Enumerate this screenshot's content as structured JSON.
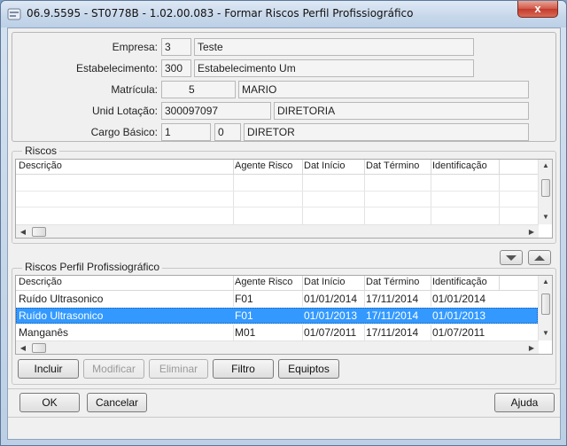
{
  "window": {
    "title": "06.9.5595 - ST0778B - 1.02.00.083 - Formar Riscos Perfil Profissiográfico",
    "close_label": "x"
  },
  "header": {
    "empresa_label": "Empresa:",
    "empresa_code": "3",
    "empresa_name": "Teste",
    "estabelecimento_label": "Estabelecimento:",
    "estabelecimento_code": "300",
    "estabelecimento_name": "Estabelecimento Um",
    "matricula_label": "Matrícula:",
    "matricula_code": "5",
    "matricula_name": "MARIO",
    "unid_lotacao_label": "Unid Lotação:",
    "unid_lotacao_code": "300097097",
    "unid_lotacao_name": "DIRETORIA",
    "cargo_label": "Cargo Básico:",
    "cargo_code": "1",
    "cargo_level": "0",
    "cargo_name": "DIRETOR"
  },
  "riscos": {
    "title": "Riscos",
    "columns": [
      "Descrição",
      "Agente Risco",
      "Dat Início",
      "Dat Término",
      "Identificação"
    ]
  },
  "perfil": {
    "title": "Riscos Perfil Profissiográfico",
    "columns": [
      "Descrição",
      "Agente Risco",
      "Dat Início",
      "Dat Término",
      "Identificação"
    ],
    "rows": [
      [
        "Ruído Ultrasonico",
        "F01",
        "01/01/2014",
        "17/11/2014",
        "01/01/2014"
      ],
      [
        "Ruído Ultrasonico",
        "F01",
        "01/01/2013",
        "17/11/2014",
        "01/01/2013"
      ],
      [
        "Manganês",
        "M01",
        "01/07/2011",
        "17/11/2014",
        "01/07/2011"
      ]
    ],
    "selected_row": 1
  },
  "actions": {
    "incluir": "Incluir",
    "modificar": "Modificar",
    "eliminar": "Eliminar",
    "filtro": "Filtro",
    "equiptos": "Equiptos"
  },
  "footer": {
    "ok": "OK",
    "cancelar": "Cancelar",
    "ajuda": "Ajuda"
  },
  "icons": {
    "app": "app-icon",
    "move_down": "move-down-icon",
    "move_up": "move-up-icon"
  },
  "colors": {
    "selection": "#3399ff",
    "close": "#c43a2b"
  }
}
